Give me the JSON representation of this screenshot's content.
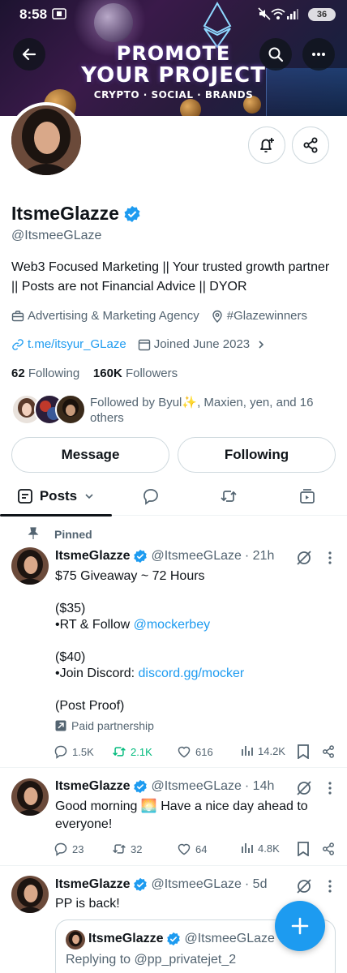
{
  "status_bar": {
    "time": "8:58",
    "battery": "36"
  },
  "banner": {
    "title_line1": "PROMOTE",
    "title_line2": "YOUR PROJECT",
    "subtitle": "CRYPTO · SOCIAL · BRANDS"
  },
  "profile": {
    "display_name": "ItsmeGlazze",
    "handle": "@ItsmeeGLaze",
    "bio": "Web3 Focused Marketing || Your trusted growth partner || Posts are not Financial Advice || DYOR",
    "category": "Advertising & Marketing Agency",
    "location": "#Glazewinners",
    "link": "t.me/itsyur_GLaze",
    "joined": "Joined June 2023",
    "following_count": "62",
    "following_label": "Following",
    "followers_count": "160K",
    "followers_label": "Followers",
    "followed_by": "Followed by Byul✨, Maxien, yen, and 16 others"
  },
  "buttons": {
    "message": "Message",
    "following": "Following"
  },
  "tabs": {
    "posts": "Posts"
  },
  "tweets": [
    {
      "pinned_label": "Pinned",
      "name": "ItsmeGlazze",
      "handle": "@ItsmeeGLaze",
      "time": "· 21h",
      "lines": {
        "l1": "$75 Giveaway ~ 72 Hours",
        "l2": "($35)",
        "l3_prefix": "•RT & Follow ",
        "l3_link": "@mockerbey",
        "l4": "($40)",
        "l5_prefix": "•Join Discord: ",
        "l5_link": "discord.gg/mocker",
        "l6": "(Post Proof)"
      },
      "paid_label": "Paid partnership",
      "replies": "1.5K",
      "reposts": "2.1K",
      "likes": "616",
      "views": "14.2K"
    },
    {
      "name": "ItsmeGlazze",
      "handle": "@ItsmeeGLaze",
      "time": "· 14h",
      "text_before": "Good morning ",
      "text_emoji": "🌅",
      "text_after": " Have a nice day ahead to everyone!",
      "replies": "23",
      "reposts": "32",
      "likes": "64",
      "views": "4.8K"
    },
    {
      "name": "ItsmeGlazze",
      "handle": "@ItsmeeGLaze",
      "time": "· 5d",
      "text": "PP is back!",
      "quote": {
        "name": "ItsmeGlazze",
        "handle": "@ItsmeeGLaze",
        "replying_to": "Replying to @pp_privatejet_2"
      }
    }
  ],
  "colors": {
    "accent": "#1d9bf0",
    "repost_active": "#00ba7c",
    "text": "#0f1419",
    "muted": "#536471"
  }
}
